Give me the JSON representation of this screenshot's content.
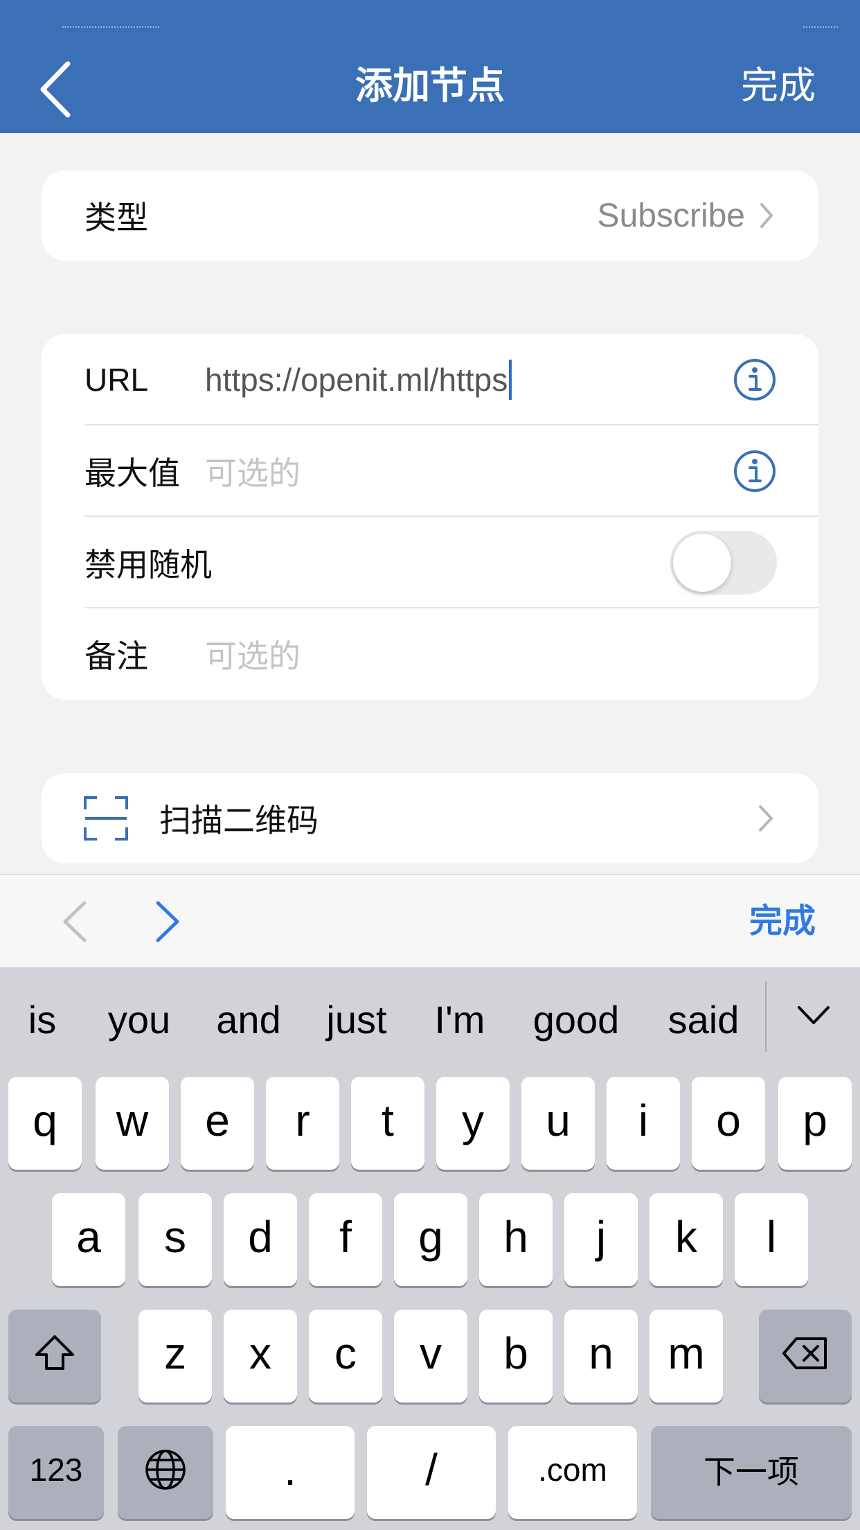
{
  "nav": {
    "title": "添加节点",
    "done": "完成"
  },
  "type_row": {
    "label": "类型",
    "value": "Subscribe"
  },
  "form": {
    "url": {
      "label": "URL",
      "value": "https://openit.ml/https"
    },
    "max": {
      "label": "最大值",
      "placeholder": "可选的"
    },
    "disable_random": {
      "label": "禁用随机",
      "enabled": false
    },
    "note": {
      "label": "备注",
      "placeholder": "可选的"
    }
  },
  "scan": {
    "label": "扫描二维码"
  },
  "accessory": {
    "done": "完成"
  },
  "keyboard": {
    "suggestions": [
      "is",
      "you",
      "and",
      "just",
      "I'm",
      "good",
      "said"
    ],
    "row1": [
      "q",
      "w",
      "e",
      "r",
      "t",
      "y",
      "u",
      "i",
      "o",
      "p"
    ],
    "row2": [
      "a",
      "s",
      "d",
      "f",
      "g",
      "h",
      "j",
      "k",
      "l"
    ],
    "row3": [
      "z",
      "x",
      "c",
      "v",
      "b",
      "n",
      "m"
    ],
    "numbers": "123",
    "dot": ".",
    "slash": "/",
    "dotcom": ".com",
    "next": "下一项"
  }
}
